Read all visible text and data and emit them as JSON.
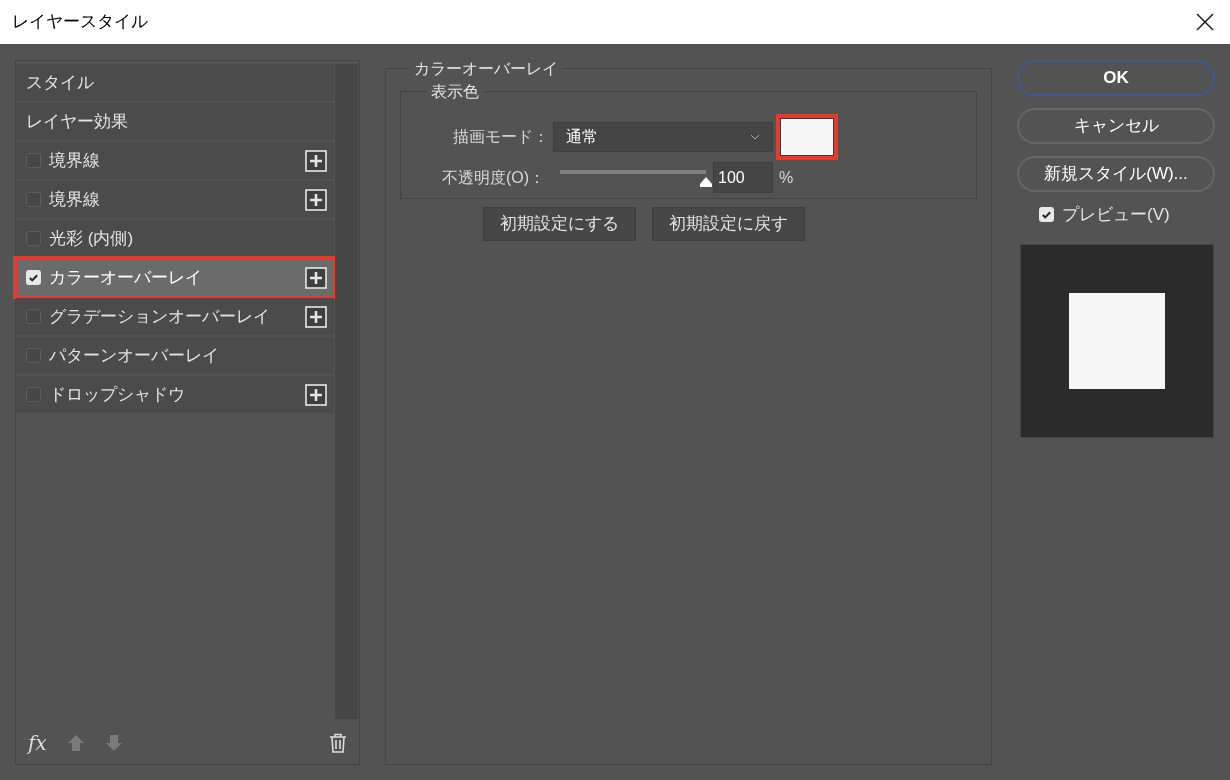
{
  "window": {
    "title": "レイヤースタイル"
  },
  "sidebar": {
    "items": [
      {
        "kind": "header",
        "label": "スタイル",
        "selected": false,
        "highlighted": false
      },
      {
        "kind": "header",
        "label": "レイヤー効果",
        "selected": false,
        "highlighted": false
      },
      {
        "kind": "effect",
        "label": "境界線",
        "checked": false,
        "selected": false,
        "highlighted": false,
        "addable": true
      },
      {
        "kind": "effect",
        "label": "境界線",
        "checked": false,
        "selected": false,
        "highlighted": false,
        "addable": true
      },
      {
        "kind": "effect",
        "label": "光彩 (内側)",
        "checked": false,
        "selected": false,
        "highlighted": false,
        "addable": false
      },
      {
        "kind": "effect",
        "label": "カラーオーバーレイ",
        "checked": true,
        "selected": true,
        "highlighted": true,
        "addable": true
      },
      {
        "kind": "effect",
        "label": "グラデーションオーバーレイ",
        "checked": false,
        "selected": false,
        "highlighted": false,
        "addable": true
      },
      {
        "kind": "effect",
        "label": "パターンオーバーレイ",
        "checked": false,
        "selected": false,
        "highlighted": false,
        "addable": false
      },
      {
        "kind": "effect",
        "label": "ドロップシャドウ",
        "checked": false,
        "selected": false,
        "highlighted": false,
        "addable": true
      }
    ],
    "footer": {
      "fx_label": "fx"
    }
  },
  "panel": {
    "title": "カラーオーバーレイ",
    "group_title": "表示色",
    "blend_mode": {
      "label": "描画モード：",
      "value": "通常"
    },
    "swatch": {
      "color": "#f7f6f6",
      "highlighted": true
    },
    "opacity": {
      "label": "不透明度(O)：",
      "level": 1,
      "value": "100",
      "unit": "%"
    },
    "buttons": [
      "初期設定にする",
      "初期設定に戻す"
    ]
  },
  "actions": [
    {
      "label": "OK",
      "default": true
    },
    {
      "label": "キャンセル",
      "default": false
    },
    {
      "label": "新規スタイル(W)...",
      "default": false
    }
  ],
  "preview": {
    "label": "プレビュー(V)",
    "checked": true
  }
}
